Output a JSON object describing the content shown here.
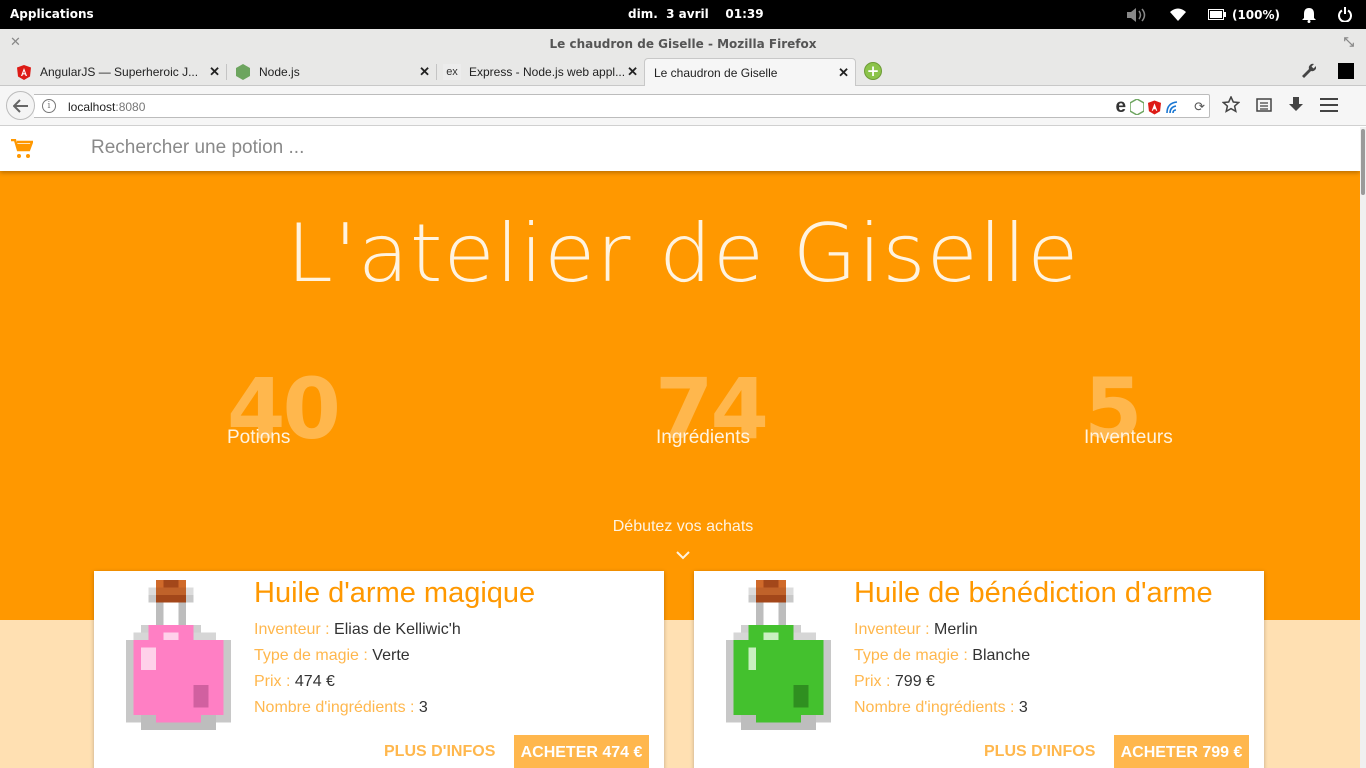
{
  "os": {
    "apps_label": "Applications",
    "clock": "dim.  3 avril    01:39",
    "battery": "(100%)"
  },
  "window": {
    "title": "Le chaudron de Giselle - Mozilla Firefox"
  },
  "tabs": [
    {
      "label": "AngularJS — Superheroic J...",
      "icon": "angular-icon"
    },
    {
      "label": "Node.js",
      "icon": "nodejs-icon"
    },
    {
      "label": "Express - Node.js web appl...",
      "icon": "express-icon"
    },
    {
      "label": "Le chaudron de Giselle",
      "icon": "none"
    }
  ],
  "url": {
    "host": "localhost",
    "port": ":8080"
  },
  "page": {
    "search_placeholder": "Rechercher une potion ...",
    "hero_title": "L'atelier de Giselle",
    "stats": [
      {
        "value": "40",
        "label": "Potions"
      },
      {
        "value": "74",
        "label": "Ingrédients"
      },
      {
        "value": "5",
        "label": "Inventeurs"
      }
    ],
    "start_label": "Débutez vos achats",
    "labels": {
      "inventor": "Inventeur : ",
      "magic": "Type de magie : ",
      "price": "Prix : ",
      "ingredients": "Nombre d'ingrédients : ",
      "more": "PLUS D'INFOS"
    },
    "cards": [
      {
        "title": "Huile d'arme magique",
        "inventor": "Elias de Kelliwic'h",
        "magic": "Verte",
        "price": "474 €",
        "ingredients": "3",
        "buy": "ACHETER 474 €",
        "liquid_color": "#ff7fc4"
      },
      {
        "title": "Huile de bénédiction d'arme",
        "inventor": "Merlin",
        "magic": "Blanche",
        "price": "799 €",
        "ingredients": "3",
        "buy": "ACHETER 799 €",
        "liquid_color": "#44c12e"
      }
    ]
  },
  "colors": {
    "accent": "#ff9800",
    "accent_light": "#ffb74d",
    "page_bg": "#ffe0b2"
  }
}
